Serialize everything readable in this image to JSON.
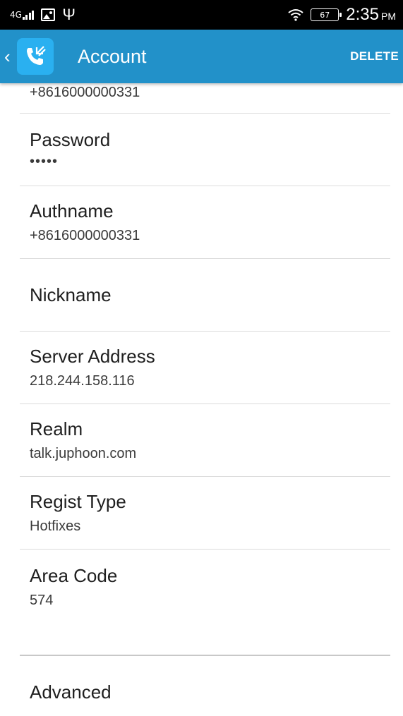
{
  "status_bar": {
    "network": "4G",
    "battery": "67",
    "time": "2:35",
    "ampm": "PM"
  },
  "appbar": {
    "title": "Account",
    "delete_label": "DELETE"
  },
  "account": {
    "username_value": "+8616000000331",
    "items": [
      {
        "title": "Password",
        "value": "•••••"
      },
      {
        "title": "Authname",
        "value": "+8616000000331"
      },
      {
        "title": "Nickname",
        "value": ""
      },
      {
        "title": "Server Address",
        "value": "218.244.158.116"
      },
      {
        "title": "Realm",
        "value": "talk.juphoon.com"
      },
      {
        "title": "Regist Type",
        "value": "Hotfixes"
      },
      {
        "title": "Area Code",
        "value": "574"
      }
    ]
  },
  "advanced_label": "Advanced"
}
